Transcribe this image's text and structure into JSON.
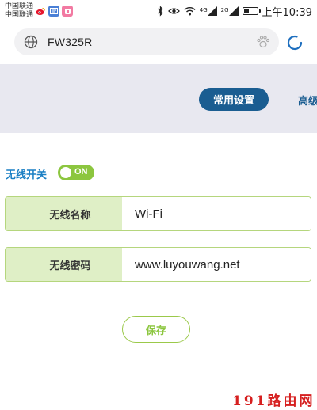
{
  "status_bar": {
    "carrier_1": "中国联通",
    "carrier_2": "中国联通",
    "app_icons": [
      "weibo-icon",
      "news-app-icon",
      "pink-app-icon"
    ],
    "indicators": [
      "bluetooth-icon",
      "eye-icon",
      "wifi-icon",
      "signal-4g-icon",
      "signal-2g-icon",
      "battery-icon"
    ],
    "network_1": "4G",
    "network_2": "2G",
    "battery_level": 0.35,
    "time": "上午10:39"
  },
  "browser": {
    "url": "FW325R",
    "site_icon": "globe-icon",
    "extension_icon": "paw-icon",
    "refresh_icon": "refresh-icon"
  },
  "tabs": {
    "active": "常用设置",
    "next": "高级"
  },
  "wireless": {
    "toggle_label": "无线开关",
    "toggle_state": "ON",
    "ssid_label": "无线名称",
    "ssid_value": "Wi-Fi",
    "password_label": "无线密码",
    "password_value": "www.luyouwang.net",
    "save_label": "保存"
  },
  "watermark": "191路由网",
  "colors": {
    "tab_active": "#1a5d91",
    "toggle_on": "#8cc63f",
    "label_blue": "#1a7fc4",
    "field_label_bg": "#dfefc6",
    "field_border": "#b5d67d",
    "band_bg": "#e8e8f0",
    "watermark": "#d62020"
  }
}
